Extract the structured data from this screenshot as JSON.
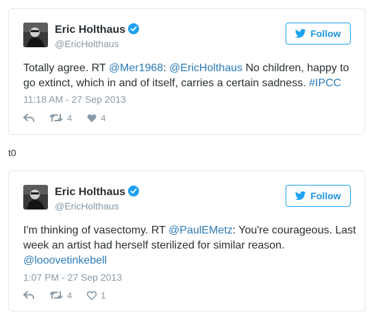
{
  "tweets": [
    {
      "display_name": "Eric Holthaus",
      "handle": "@EricHolthaus",
      "follow_label": "Follow",
      "text_parts": [
        {
          "type": "text",
          "value": "Totally agree. RT "
        },
        {
          "type": "link",
          "value": "@Mer1968"
        },
        {
          "type": "text",
          "value": ": "
        },
        {
          "type": "link",
          "value": "@EricHolthaus"
        },
        {
          "type": "text",
          "value": " No children, happy to go extinct, which in and of itself, carries a certain sadness. "
        },
        {
          "type": "link",
          "value": "#IPCC"
        }
      ],
      "timestamp": "11:18 AM - 27 Sep 2013",
      "retweets": "4",
      "likes": "4"
    },
    {
      "display_name": "Eric Holthaus",
      "handle": "@EricHolthaus",
      "follow_label": "Follow",
      "text_parts": [
        {
          "type": "text",
          "value": "I'm thinking of vasectomy. RT "
        },
        {
          "type": "link",
          "value": "@PaulEMetz"
        },
        {
          "type": "text",
          "value": ": You're courageous. Last week an artist had herself sterilized for similar reason. "
        },
        {
          "type": "link",
          "value": "@looovetinkebell"
        }
      ],
      "timestamp": "1:07 PM - 27 Sep 2013",
      "retweets": "4",
      "likes": "1"
    }
  ],
  "separator": "t0",
  "icons": {
    "verified": "verified-badge-icon",
    "follow": "twitter-bird-icon",
    "reply": "reply-icon",
    "retweet": "retweet-icon",
    "like": "heart-icon"
  },
  "colors": {
    "link": "#2b7bb9",
    "follow_blue": "#1da1f2",
    "muted": "#8899a6",
    "text": "#292f33",
    "border": "#e1e8ed"
  }
}
